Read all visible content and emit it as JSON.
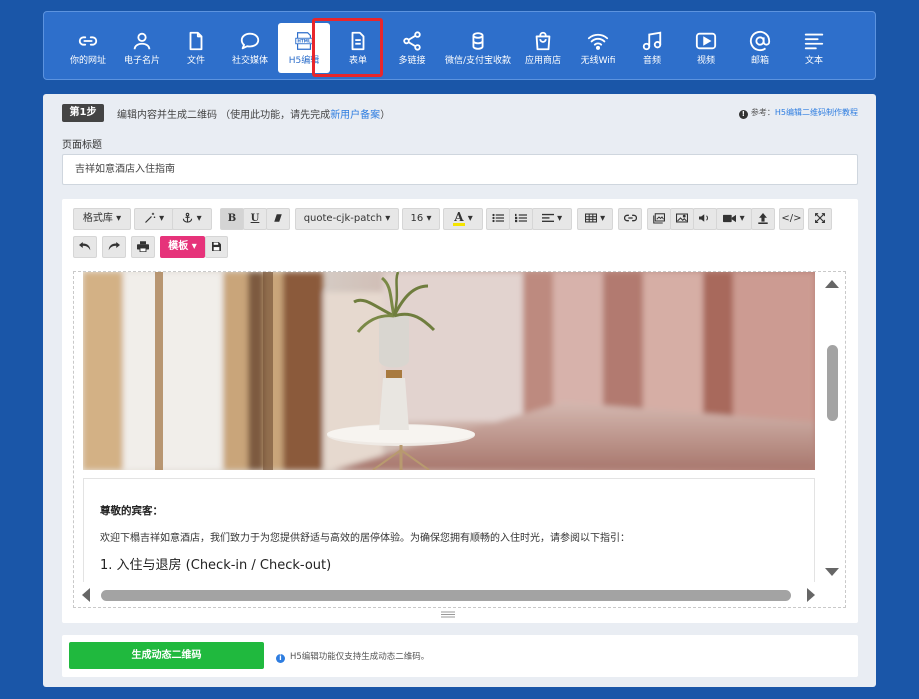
{
  "nav": {
    "items": [
      {
        "label": "你的网址",
        "icon": "link-icon"
      },
      {
        "label": "电子名片",
        "icon": "person-icon"
      },
      {
        "label": "文件",
        "icon": "file-icon"
      },
      {
        "label": "社交媒体",
        "icon": "chat-bubble-icon"
      },
      {
        "label": "H5编辑",
        "icon": "html-icon"
      },
      {
        "label": "表单",
        "icon": "form-icon"
      },
      {
        "label": "多链接",
        "icon": "share-icon"
      },
      {
        "label": "微信/支付宝收款",
        "icon": "coin-icon"
      },
      {
        "label": "应用商店",
        "icon": "shopping-bag-icon"
      },
      {
        "label": "无线Wifi",
        "icon": "wifi-icon"
      },
      {
        "label": "音频",
        "icon": "music-icon"
      },
      {
        "label": "视频",
        "icon": "video-play-icon"
      },
      {
        "label": "邮箱",
        "icon": "at-icon"
      },
      {
        "label": "文本",
        "icon": "text-lines-icon"
      }
    ],
    "html_icon_text": "HTML",
    "active_label": "H5编辑"
  },
  "step": {
    "badge": "第1步",
    "text": "编辑内容并生成二维码 （使用此功能，请先完成",
    "link": "新用户备案",
    "close_paren": "）"
  },
  "reference": {
    "prefix": "参考：",
    "link": "H5编辑二维码制作教程"
  },
  "page_title": {
    "label": "页面标题",
    "value": "吉祥如意酒店入住指南"
  },
  "toolbar": {
    "style_lib": "格式库",
    "font_name": "quote-cjk-patch",
    "font_size": "16",
    "template": "模板",
    "bold": "B",
    "underline": "U",
    "font_color_letter": "A",
    "code": "</>"
  },
  "content": {
    "greeting": "尊敬的宾客：",
    "welcome": "欢迎下榻吉祥如意酒店，我们致力于为您提供舒适与高效的居停体验。为确保您拥有顺畅的入住时光，请参阅以下指引：",
    "section1": "1. 入住与退房 (Check-in / Check-out)"
  },
  "bottom": {
    "generate_button": "生成动态二维码",
    "note": "H5编辑功能仅支持生成动态二维码。"
  },
  "colors": {
    "background": "#1a56a8",
    "nav_bar": "#2e6fcb",
    "highlight_border": "#e8262b",
    "template_button": "#e6337a",
    "generate_button": "#20b93e",
    "link": "#2e7de0"
  }
}
